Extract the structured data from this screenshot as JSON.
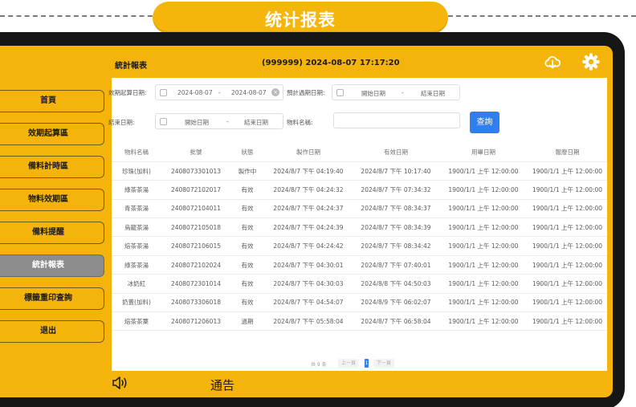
{
  "banner": {
    "title": "统计报表"
  },
  "header": {
    "title": "統計報表",
    "info": "(999999)  2024-08-07 17:17:20",
    "cloud_icon": "cloud-download-icon",
    "settings_icon": "gear-icon"
  },
  "sidebar": {
    "items": [
      {
        "label": "首頁"
      },
      {
        "label": "效期起算區"
      },
      {
        "label": "備料計時區"
      },
      {
        "label": "物料效期區"
      },
      {
        "label": "備料提醒"
      },
      {
        "label": "統計報表"
      },
      {
        "label": "標籤重印查詢"
      },
      {
        "label": "退出"
      }
    ],
    "active_index": 5
  },
  "filters": {
    "start_label": "效期起算日期:",
    "start_from": "2024-08-07",
    "start_sep": "-",
    "start_to": "2024-08-07",
    "expire_label": "預計過期日期:",
    "expire_from": "開始日期",
    "expire_sep": "-",
    "expire_to": "結束日期",
    "end_label": "結束日期:",
    "end_from": "開始日期",
    "end_sep": "-",
    "end_to": "結束日期",
    "name_label": "物料名稱:",
    "name_value": "",
    "search_label": "查詢"
  },
  "table": {
    "columns": [
      "物料名稱",
      "批號",
      "狀態",
      "製作日期",
      "有效日期",
      "用畢日期",
      "報廢日期"
    ],
    "rows": [
      [
        "珍珠(加料)",
        "2408073301013",
        "製作中",
        "2024/8/7 下午 04:19:40",
        "2024/8/7 下午 10:17:40",
        "1900/1/1 上午 12:00:00",
        "1900/1/1 上午 12:00:00"
      ],
      [
        "綠茶茶湯",
        "2408072102017",
        "有效",
        "2024/8/7 下午 04:24:32",
        "2024/8/7 下午 07:34:32",
        "1900/1/1 上午 12:00:00",
        "1900/1/1 上午 12:00:00"
      ],
      [
        "青茶茶湯",
        "2408072104011",
        "有效",
        "2024/8/7 下午 04:24:37",
        "2024/8/7 下午 08:34:37",
        "1900/1/1 上午 12:00:00",
        "1900/1/1 上午 12:00:00"
      ],
      [
        "烏龍茶湯",
        "2408072105018",
        "有效",
        "2024/8/7 下午 04:24:39",
        "2024/8/7 下午 08:34:39",
        "1900/1/1 上午 12:00:00",
        "1900/1/1 上午 12:00:00"
      ],
      [
        "焙茶茶湯",
        "2408072106015",
        "有效",
        "2024/8/7 下午 04:24:42",
        "2024/8/7 下午 08:34:42",
        "1900/1/1 上午 12:00:00",
        "1900/1/1 上午 12:00:00"
      ],
      [
        "綠茶茶湯",
        "2408072102024",
        "有效",
        "2024/8/7 下午 04:30:01",
        "2024/8/7 下午 07:40:01",
        "1900/1/1 上午 12:00:00",
        "1900/1/1 上午 12:00:00"
      ],
      [
        "冰奶紅",
        "2408072301014",
        "有效",
        "2024/8/7 下午 04:30:03",
        "2024/8/8 下午 04:50:03",
        "1900/1/1 上午 12:00:00",
        "1900/1/1 上午 12:00:00"
      ],
      [
        "奶蓋(加料)",
        "2408073306018",
        "有效",
        "2024/8/7 下午 04:54:07",
        "2024/8/9 下午 06:02:07",
        "1900/1/1 上午 12:00:00",
        "1900/1/1 上午 12:00:00"
      ],
      [
        "焙茶茶葉",
        "2408071206013",
        "過期",
        "2024/8/7 下午 05:58:04",
        "2024/8/7 下午 06:58:04",
        "1900/1/1 上午 12:00:00",
        "1900/1/1 上午 12:00:00"
      ]
    ]
  },
  "pagination": {
    "total": "共 9 条",
    "prev": "上一頁",
    "current": "1",
    "next": "下一頁"
  },
  "footer": {
    "speaker_icon": "speaker-icon",
    "notice": "通告"
  },
  "colors": {
    "brand_yellow": "#f4b40c",
    "frame": "#161616",
    "active_nav": "#8c8c8c",
    "primary_button": "#2f7ff0"
  }
}
